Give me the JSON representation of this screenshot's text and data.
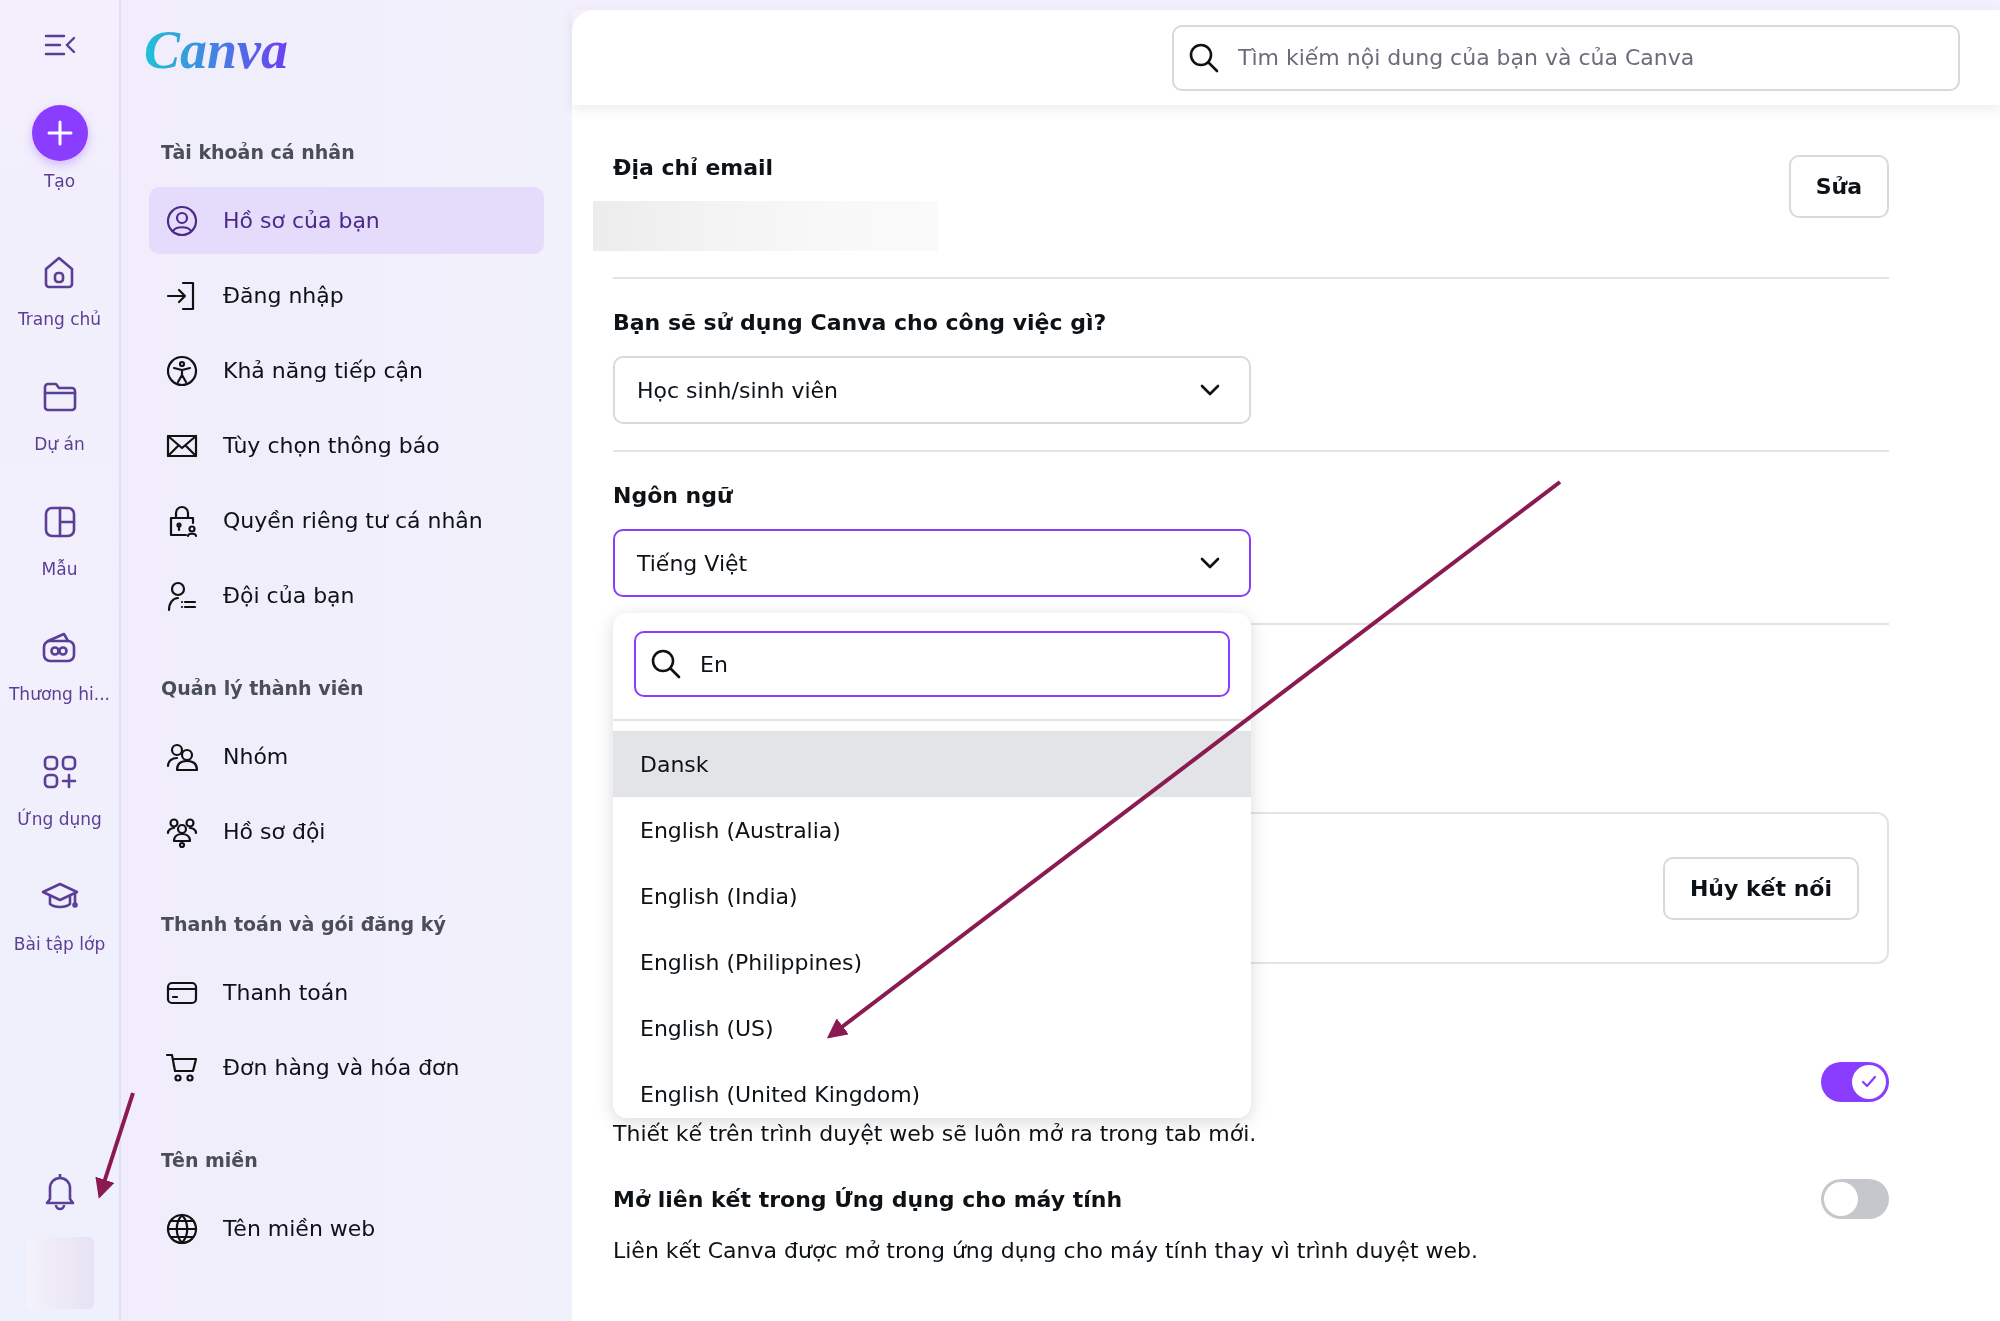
{
  "rail": {
    "items": [
      {
        "label": "Tạo",
        "kind": "create"
      },
      {
        "label": "Trang chủ",
        "kind": "home"
      },
      {
        "label": "Dự án",
        "kind": "folder"
      },
      {
        "label": "Mẫu",
        "kind": "template"
      },
      {
        "label": "Thương hi...",
        "kind": "brand"
      },
      {
        "label": "Ứng dụng",
        "kind": "apps"
      },
      {
        "label": "Bài tập lớp",
        "kind": "class"
      }
    ]
  },
  "logo": "Canva",
  "sidebar": {
    "sections": [
      {
        "title": "Tài khoản cá nhân",
        "items": [
          {
            "label": "Hồ sơ của bạn",
            "kind": "profile",
            "selected": true
          },
          {
            "label": "Đăng nhập",
            "kind": "login",
            "selected": false
          },
          {
            "label": "Khả năng tiếp cận",
            "kind": "access",
            "selected": false
          },
          {
            "label": "Tùy chọn thông báo",
            "kind": "mail",
            "selected": false
          },
          {
            "label": "Quyền riêng tư cá nhân",
            "kind": "privacy",
            "selected": false
          },
          {
            "label": "Đội của bạn",
            "kind": "team",
            "selected": false
          }
        ]
      },
      {
        "title": "Quản lý thành viên",
        "items": [
          {
            "label": "Nhóm",
            "kind": "group",
            "selected": false
          },
          {
            "label": "Hồ sơ đội",
            "kind": "teams",
            "selected": false
          }
        ]
      },
      {
        "title": "Thanh toán và gói đăng ký",
        "items": [
          {
            "label": "Thanh toán",
            "kind": "card",
            "selected": false
          },
          {
            "label": "Đơn hàng và hóa đơn",
            "kind": "cart",
            "selected": false
          }
        ]
      },
      {
        "title": "Tên miền",
        "items": [
          {
            "label": "Tên miền web",
            "kind": "globe",
            "selected": false
          }
        ]
      }
    ]
  },
  "search": {
    "placeholder": "Tìm kiếm nội dung của bạn và của Canva"
  },
  "email": {
    "label": "Địa chỉ email",
    "button": "Sửa"
  },
  "usage": {
    "label": "Bạn sẽ sử dụng Canva cho công việc gì?",
    "value": "Học sinh/sinh viên"
  },
  "language": {
    "label": "Ngôn ngữ",
    "value": "Tiếng Việt",
    "dropdown": {
      "search_value": "En",
      "options": [
        {
          "label": "Dansk",
          "selected": true
        },
        {
          "label": "English (Australia)",
          "selected": false
        },
        {
          "label": "English (India)",
          "selected": false
        },
        {
          "label": "English (Philippines)",
          "selected": false
        },
        {
          "label": "English (US)",
          "selected": false
        },
        {
          "label": "English (United Kingdom)",
          "selected": false
        }
      ]
    }
  },
  "connection": {
    "button": "Hủy kết nối"
  },
  "settings": [
    {
      "description": "Thiết kế trên trình duyệt web sẽ luôn mở ra trong tab mới.",
      "on": true
    },
    {
      "title": "Mở liên kết trong Ứng dụng cho máy tính",
      "description": "Liên kết Canva được mở trong ứng dụng cho máy tính thay vì trình duyệt web.",
      "on": false
    }
  ]
}
